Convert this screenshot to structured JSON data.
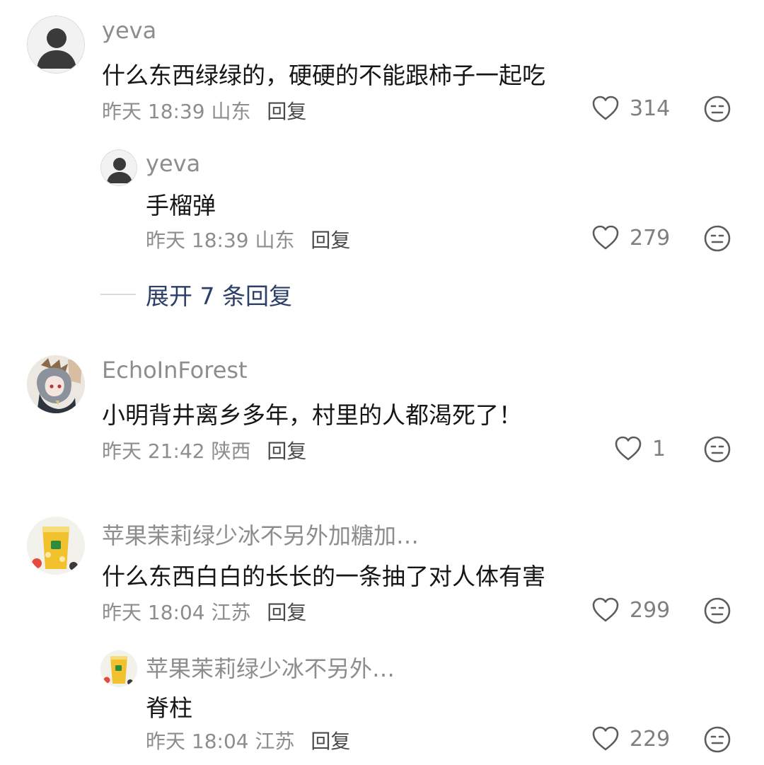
{
  "comments": [
    {
      "username": "yeva",
      "text": "什么东西绿绿的，硬硬的不能跟柿子一起吃",
      "time": "昨天 18:39",
      "location": "山东",
      "reply_label": "回复",
      "likes": "314",
      "avatar": "default-avatar",
      "replies": [
        {
          "username": "yeva",
          "text": "手榴弹",
          "time": "昨天 18:39",
          "location": "山东",
          "reply_label": "回复",
          "likes": "279",
          "avatar": "default-avatar"
        }
      ],
      "expand_label": "展开 7 条回复"
    },
    {
      "username": "EchoInForest",
      "text": "小明背井离乡多年，村里的人都渴死了！",
      "time": "昨天 21:42",
      "location": "陕西",
      "reply_label": "回复",
      "likes": "1",
      "avatar": "anime-character-avatar"
    },
    {
      "username": "苹果茉莉绿少冰不另外加糖加…",
      "text": "什么东西白白的长长的一条抽了对人体有害",
      "time": "昨天 18:04",
      "location": "江苏",
      "reply_label": "回复",
      "likes": "299",
      "avatar": "fruit-tea-avatar",
      "replies": [
        {
          "username": "苹果茉莉绿少冰不另外…",
          "text": "脊柱",
          "time": "昨天 18:04",
          "location": "江苏",
          "reply_label": "回复",
          "likes": "229",
          "avatar": "fruit-tea-avatar"
        }
      ]
    }
  ],
  "icons": {
    "like": "heart-outline-icon",
    "dislike": "meh-face-icon"
  },
  "colors": {
    "meta": "#8d8d8d",
    "expand_link": "#2b3f68",
    "icon": "#5c5c5c"
  }
}
